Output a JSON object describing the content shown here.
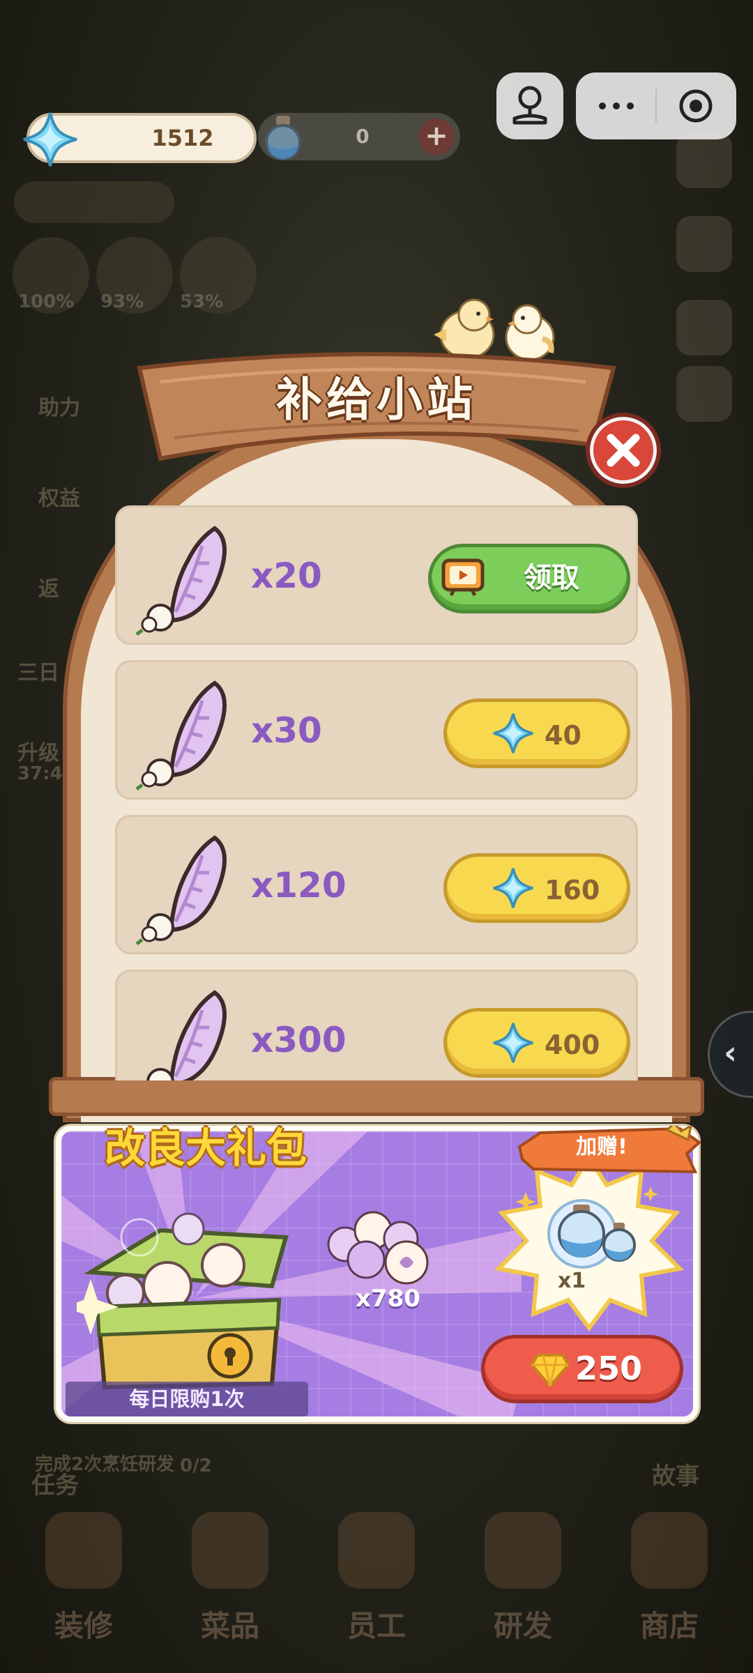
{
  "hud": {
    "gems": "1512",
    "potions": "0",
    "plus_label": "+"
  },
  "background": {
    "stats": [
      "100%",
      "93%",
      "53%"
    ],
    "left_labels": [
      "助力",
      "权益",
      "返",
      "三日",
      "升级",
      "37:4"
    ],
    "task_label": "任务",
    "task_desc": "完成2次烹饪研发",
    "task_progress": "0/2",
    "story_label": "故事",
    "nav": [
      "装修",
      "菜品",
      "员工",
      "研发",
      "商店"
    ]
  },
  "modal": {
    "title": "补给小站",
    "offers": [
      {
        "qty": "x20",
        "action": "领取",
        "type": "video"
      },
      {
        "qty": "x30",
        "price": "40",
        "type": "gem"
      },
      {
        "qty": "x120",
        "price": "160",
        "type": "gem"
      },
      {
        "qty": "x300",
        "price": "400",
        "type": "gem"
      }
    ]
  },
  "bundle": {
    "title": "改良大礼包",
    "daily_limit": "每日限购1次",
    "item_qty": "x780",
    "bonus_label": "加赠!",
    "bonus_qty": "x1",
    "price": "250"
  },
  "colors": {
    "accent_green": "#7ccd5a",
    "accent_yellow": "#f8d84f",
    "accent_red": "#ef5c4c",
    "bundle_purple": "#a67de2",
    "qty_purple": "#8a5ac0"
  }
}
